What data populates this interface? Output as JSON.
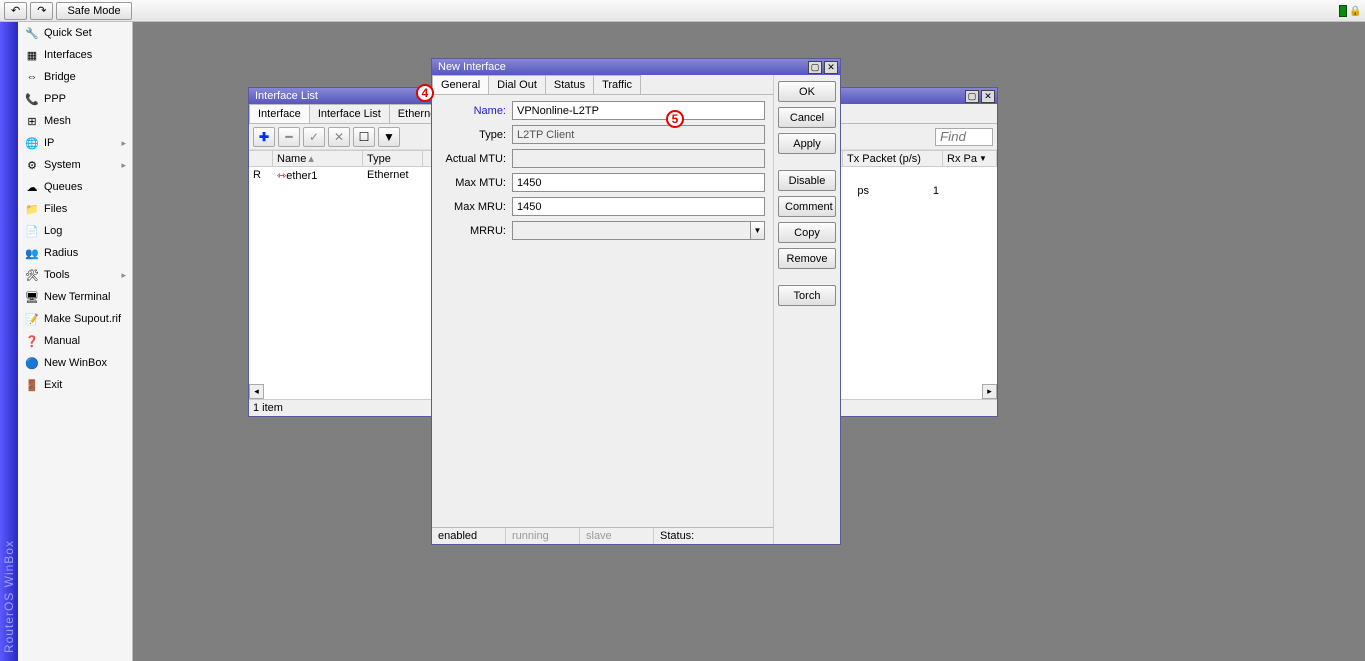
{
  "topbar": {
    "safe_mode": "Safe Mode",
    "undo_tip": "↶",
    "redo_tip": "↷"
  },
  "sidebar_title": "RouterOS WinBox",
  "sidebar": [
    {
      "icon": "🔧",
      "label": "Quick Set",
      "sub": false
    },
    {
      "icon": "▦",
      "label": "Interfaces",
      "sub": false
    },
    {
      "icon": "⇔",
      "label": "Bridge",
      "sub": false
    },
    {
      "icon": "📞",
      "label": "PPP",
      "sub": false
    },
    {
      "icon": "⊞",
      "label": "Mesh",
      "sub": false
    },
    {
      "icon": "🌐",
      "label": "IP",
      "sub": true
    },
    {
      "icon": "⚙",
      "label": "System",
      "sub": true
    },
    {
      "icon": "☁",
      "label": "Queues",
      "sub": false
    },
    {
      "icon": "📁",
      "label": "Files",
      "sub": false
    },
    {
      "icon": "📄",
      "label": "Log",
      "sub": false
    },
    {
      "icon": "👥",
      "label": "Radius",
      "sub": false
    },
    {
      "icon": "🛠",
      "label": "Tools",
      "sub": true
    },
    {
      "icon": "🖥",
      "label": "New Terminal",
      "sub": false
    },
    {
      "icon": "📝",
      "label": "Make Supout.rif",
      "sub": false
    },
    {
      "icon": "❓",
      "label": "Manual",
      "sub": false
    },
    {
      "icon": "🔵",
      "label": "New WinBox",
      "sub": false
    },
    {
      "icon": "🚪",
      "label": "Exit",
      "sub": false
    }
  ],
  "ifacelist": {
    "title": "Interface List",
    "tabs": [
      "Interface",
      "Interface List",
      "Ethernet"
    ],
    "find": "Find",
    "cols": {
      "flag": "",
      "name": "Name",
      "type": "Type",
      "txp": "Tx Packet (p/s)",
      "rxp": "Rx Pa"
    },
    "rows": [
      {
        "flag": "R",
        "name": "ether1",
        "type": "Ethernet",
        "txp": "",
        "rxp": ""
      }
    ],
    "extra_row": {
      "txp_suffix": "ps",
      "txp_val": "1"
    },
    "status": "1 item"
  },
  "newif": {
    "title": "New Interface",
    "tabs": [
      "General",
      "Dial Out",
      "Status",
      "Traffic"
    ],
    "fields": {
      "name_label": "Name:",
      "name_value": "VPNonline-L2TP",
      "type_label": "Type:",
      "type_value": "L2TP Client",
      "amtu_label": "Actual MTU:",
      "amtu_value": "",
      "mmtu_label": "Max MTU:",
      "mmtu_value": "1450",
      "mmru_label": "Max MRU:",
      "mmru_value": "1450",
      "mrru_label": "MRRU:",
      "mrru_value": ""
    },
    "buttons": [
      "OK",
      "Cancel",
      "Apply",
      "Disable",
      "Comment",
      "Copy",
      "Remove",
      "Torch"
    ],
    "status": {
      "enabled": "enabled",
      "running": "running",
      "slave": "slave",
      "label": "Status:"
    }
  },
  "anno": {
    "four": "4",
    "five": "5"
  }
}
